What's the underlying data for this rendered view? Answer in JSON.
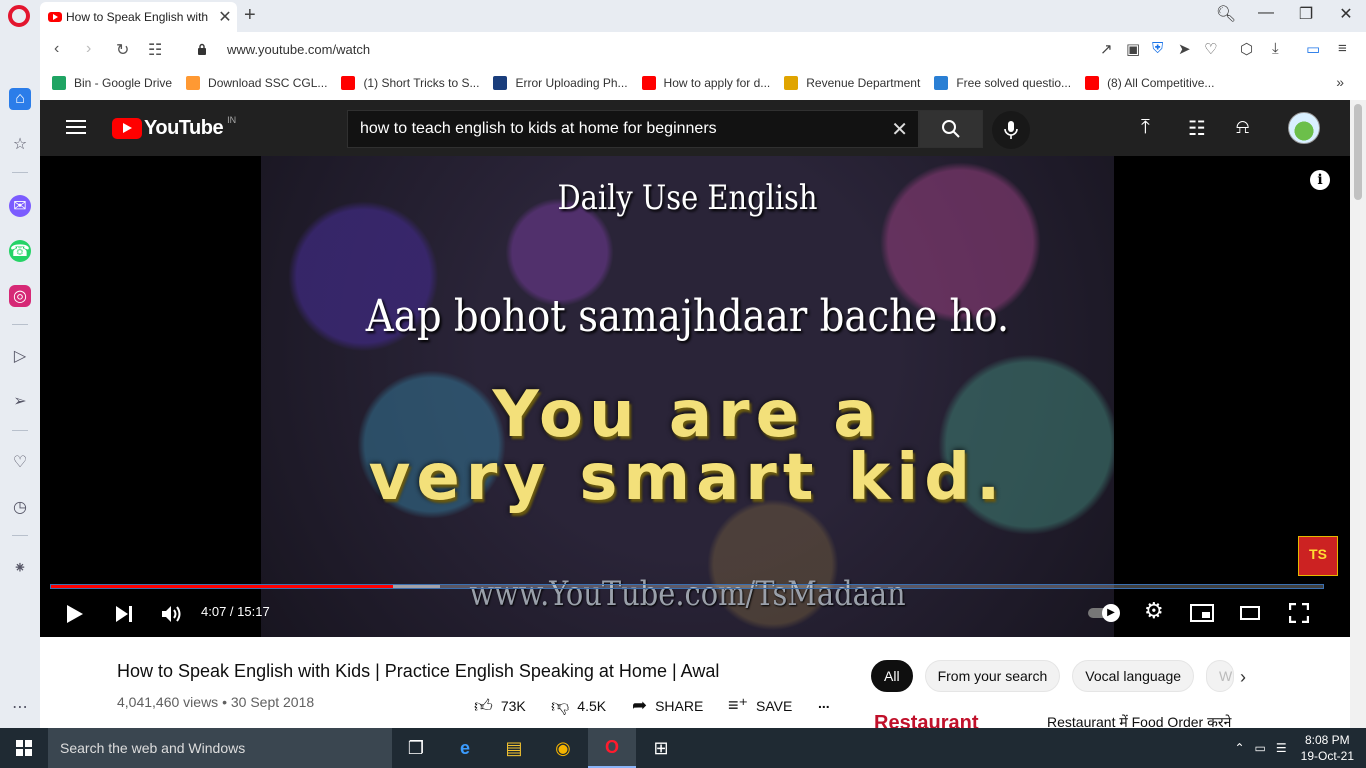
{
  "browser": {
    "tab_title": "How to Speak English with",
    "tab_close": "✕",
    "new_tab": "+",
    "url": "www.youtube.com/watch",
    "window_controls": [
      "search-icon",
      "minimize-icon",
      "restore-icon",
      "close-icon"
    ]
  },
  "bookmarks": [
    {
      "label": "Bin - Google Drive",
      "color": "#1fa463"
    },
    {
      "label": "Download SSC CGL...",
      "color": "#ff9933"
    },
    {
      "label": "(1) Short Tricks to S...",
      "color": "#ff0000"
    },
    {
      "label": "Error Uploading Ph...",
      "color": "#1a3d7c"
    },
    {
      "label": "How to apply for d...",
      "color": "#ff0000"
    },
    {
      "label": "Revenue Department",
      "color": "#e0a400"
    },
    {
      "label": "Free solved questio...",
      "color": "#2a7fd4"
    },
    {
      "label": "(8) All Competitive...",
      "color": "#ff0000"
    }
  ],
  "youtube": {
    "logo_text": "YouTube",
    "country_code": "IN",
    "search_value": "how to teach english to kids at home for beginners",
    "search_clear": "✕"
  },
  "video": {
    "frame_line1": "Daily Use English",
    "frame_line2": "Aap bohot samajhdaar bache ho.",
    "frame_line3": "You are a",
    "frame_line4": "very smart kid.",
    "frame_url": "www.YouTube.com/TsMadaan",
    "watermark": "TS",
    "info": "i",
    "time": "4:07 / 15:17",
    "progress_played": 0.269,
    "progress_buffered": 0.306
  },
  "details": {
    "title": "How to Speak English with Kids | Practice English Speaking at Home | Awal",
    "meta": "4,041,460 views • 30 Sept 2018",
    "likes": "73K",
    "dislikes": "4.5K",
    "share": "SHARE",
    "save": "SAVE",
    "more": "..."
  },
  "chips": [
    "All",
    "From your search",
    "Vocal language",
    "W"
  ],
  "recommendation": {
    "thumb_text": "Restaurant",
    "title": "Restaurant में Food Order करने"
  },
  "taskbar": {
    "search_placeholder": "Search the web and Windows",
    "time": "8:08 PM",
    "date": "19-Oct-21"
  }
}
